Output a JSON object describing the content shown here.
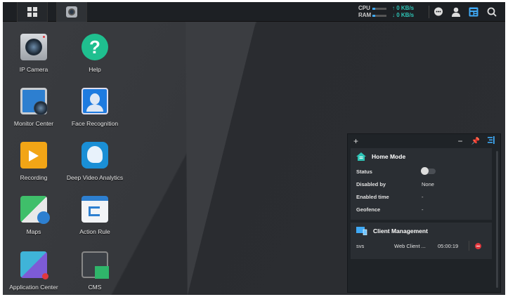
{
  "taskbar": {
    "main_menu": "main-menu",
    "open_app": "IP Camera",
    "cpu_label": "CPU",
    "ram_label": "RAM",
    "cpu_rate": "↑ 0 KB/s",
    "ram_rate": "↓ 0 KB/s",
    "cpu_usage_pct": 15,
    "ram_usage_pct": 15
  },
  "desktop": {
    "icons": [
      {
        "label": "IP Camera"
      },
      {
        "label": "Help"
      },
      {
        "label": "Monitor Center"
      },
      {
        "label": "Face Recognition"
      },
      {
        "label": "Recording"
      },
      {
        "label": "Deep Video Analytics"
      },
      {
        "label": "Maps"
      },
      {
        "label": "Action Rule"
      },
      {
        "label": "Application Center"
      },
      {
        "label": "CMS"
      }
    ]
  },
  "widget": {
    "add": "+",
    "minimize": "−",
    "home_mode": {
      "title": "Home Mode",
      "rows": [
        {
          "key": "Status",
          "value": ""
        },
        {
          "key": "Disabled by",
          "value": "None"
        },
        {
          "key": "Enabled time",
          "value": "-"
        },
        {
          "key": "Geofence",
          "value": "-"
        }
      ],
      "status_enabled": false
    },
    "client_management": {
      "title": "Client Management",
      "clients": [
        {
          "user": "svs",
          "client": "Web Client ...",
          "time": "05:00:19"
        }
      ]
    }
  },
  "colors": {
    "accent": "#3fa9f5",
    "teal": "#2ec4b6",
    "danger": "#e0383e"
  }
}
